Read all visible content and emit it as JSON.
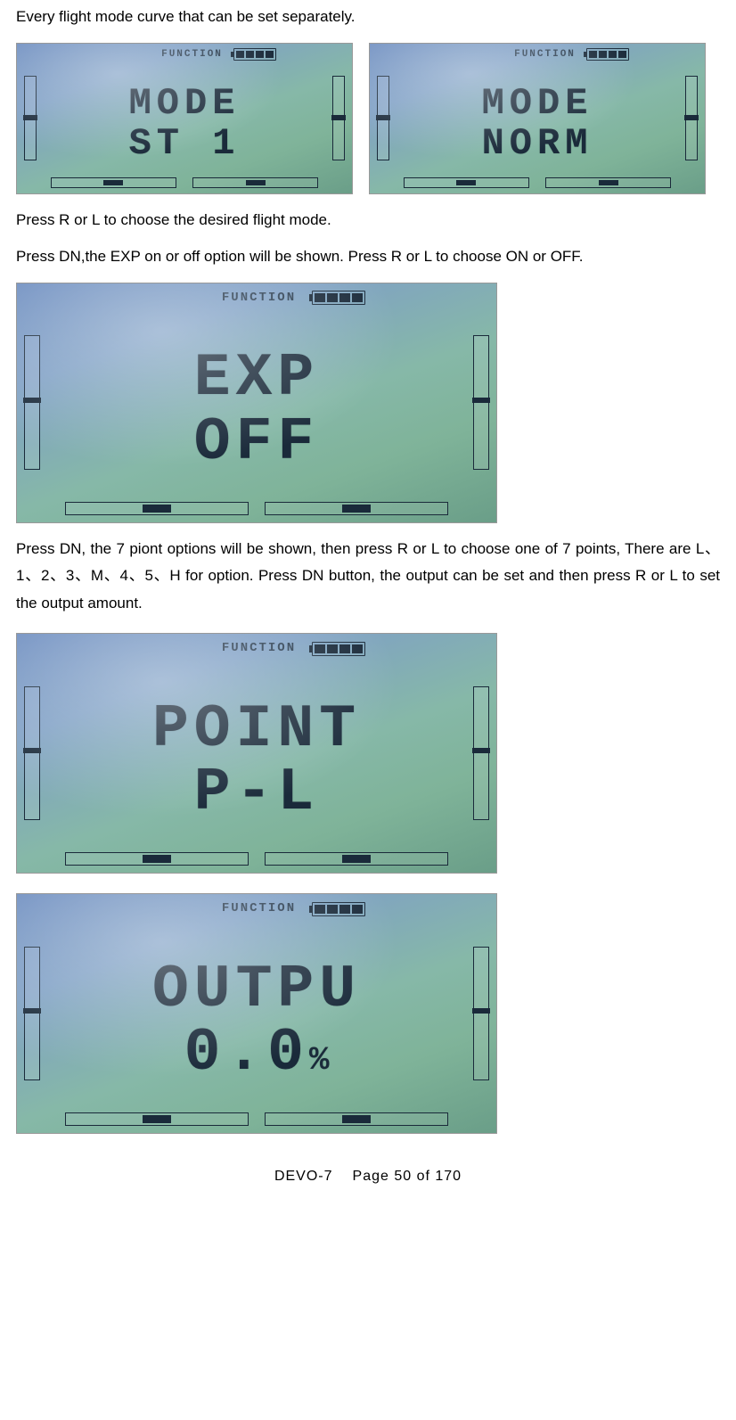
{
  "text": {
    "para1": "Every flight mode curve that can be set separately.",
    "para2": "Press R or L to choose the desired flight mode.",
    "para3": "Press DN,the EXP on or off option will be shown. Press R or L to choose ON or OFF.",
    "para4": "Press DN, the 7 piont options will be shown, then press R or L to choose one of 7 points, There are L、1、2、3、M、4、5、H for option. Press DN button, the output can be set and then press R or L to set the output amount."
  },
  "lcd_common": {
    "function_label": "FUNCTION"
  },
  "screens": {
    "mode_st1": {
      "line1": "MODE",
      "line2": "ST 1"
    },
    "mode_norm": {
      "line1": "MODE",
      "line2": "NORM"
    },
    "exp_off": {
      "line1": "EXP",
      "line2": "OFF"
    },
    "point_pl": {
      "line1": "POINT",
      "line2": "P-L"
    },
    "outpu": {
      "line1": "OUTPU",
      "line2_value": "0.0",
      "line2_unit": "%"
    }
  },
  "footer": {
    "model": "DEVO-7",
    "page_label": "Page 50 of 170"
  }
}
